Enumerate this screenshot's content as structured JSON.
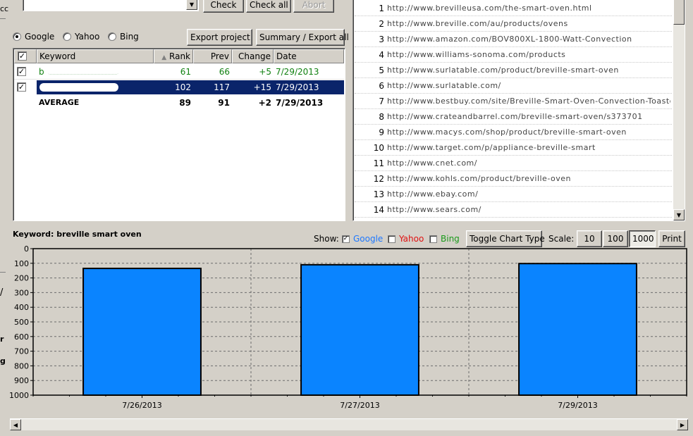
{
  "top_toolbar": {
    "check_label": "Check",
    "check_all_label": "Check all",
    "abort_label": "Abort"
  },
  "engines": {
    "google_label": "Google",
    "yahoo_label": "Yahoo",
    "bing_label": "Bing",
    "selected": "Google"
  },
  "actions": {
    "export_project_label": "Export project",
    "summary_export_label": "Summary / Export all"
  },
  "keyword_table": {
    "columns": {
      "keyword": "Keyword",
      "rank": "Rank",
      "prev": "Prev",
      "change": "Change",
      "date": "Date"
    },
    "rows": [
      {
        "keyword": "b",
        "rank": "61",
        "prev": "66",
        "change": "+5",
        "date": "7/29/2013"
      },
      {
        "keyword": "",
        "rank": "102",
        "prev": "117",
        "change": "+15",
        "date": "7/29/2013"
      },
      {
        "keyword": "AVERAGE",
        "rank": "89",
        "prev": "91",
        "change": "+2",
        "date": "7/29/2013"
      }
    ]
  },
  "url_list": {
    "rows": [
      {
        "num": "1",
        "url": "http://www.brevilleusa.com/the-smart-oven.html"
      },
      {
        "num": "2",
        "url": "http://www.breville.com/au/products/ovens"
      },
      {
        "num": "3",
        "url": "http://www.amazon.com/BOV800XL-1800-Watt-Convection"
      },
      {
        "num": "4",
        "url": "http://www.williams-sonoma.com/products"
      },
      {
        "num": "5",
        "url": "http://www.surlatable.com/product/breville-smart-oven"
      },
      {
        "num": "6",
        "url": "http://www.surlatable.com/"
      },
      {
        "num": "7",
        "url": "http://www.bestbuy.com/site/Breville-Smart-Oven-Convection-Toaster"
      },
      {
        "num": "8",
        "url": "http://www.crateandbarrel.com/breville-smart-oven/s373701"
      },
      {
        "num": "9",
        "url": "http://www.macys.com/shop/product/breville-smart-oven"
      },
      {
        "num": "10",
        "url": "http://www.target.com/p/appliance-breville-smart"
      },
      {
        "num": "11",
        "url": "http://www.cnet.com/"
      },
      {
        "num": "12",
        "url": "http://www.kohls.com/product/breville-oven"
      },
      {
        "num": "13",
        "url": "http://www.ebay.com/"
      },
      {
        "num": "14",
        "url": "http://www.sears.com/"
      }
    ]
  },
  "chart_panel": {
    "keyword_caption": "Keyword: breville smart oven",
    "show_label": "Show:",
    "google_label": "Google",
    "yahoo_label": "Yahoo",
    "bing_label": "Bing",
    "toggle_chart_label": "Toggle Chart Type",
    "scale_label": "Scale:",
    "scale_10": "10",
    "scale_100": "100",
    "scale_1000": "1000",
    "print_label": "Print",
    "colors": {
      "google": "#1e78ff",
      "yahoo": "#e01010",
      "bing": "#1a9a1a",
      "bar_fill": "#0a84ff"
    }
  },
  "colors": {
    "selection": "#0a246a",
    "positive_change": "#108010",
    "face": "#d4d0c8"
  },
  "chart_data": {
    "type": "bar",
    "categories": [
      "7/26/2013",
      "7/27/2013",
      "7/29/2013"
    ],
    "values": [
      135,
      110,
      102
    ],
    "ylim": [
      0,
      1000
    ],
    "yticks": [
      0,
      100,
      200,
      300,
      400,
      500,
      600,
      700,
      800,
      900,
      1000
    ],
    "y_inverted": true,
    "grid": true
  }
}
